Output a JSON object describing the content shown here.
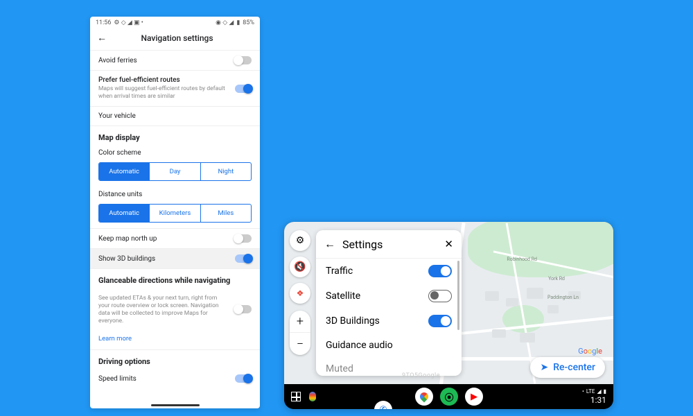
{
  "phone": {
    "status": {
      "time": "11:56",
      "battery": "85%"
    },
    "header": {
      "title": "Navigation settings"
    },
    "avoid_ferries": {
      "label": "Avoid ferries",
      "on": false
    },
    "fuel_efficient": {
      "label": "Prefer fuel-efficient routes",
      "sub": "Maps will suggest fuel-efficient routes by default when arrival times are similar",
      "on": true
    },
    "your_vehicle": {
      "label": "Your vehicle"
    },
    "map_display": {
      "title": "Map display"
    },
    "color_scheme": {
      "label": "Color scheme",
      "options": [
        "Automatic",
        "Day",
        "Night"
      ],
      "selected": 0
    },
    "distance_units": {
      "label": "Distance units",
      "options": [
        "Automatic",
        "Kilometers",
        "Miles"
      ],
      "selected": 0
    },
    "keep_north": {
      "label": "Keep map north up",
      "on": false
    },
    "show_3d": {
      "label": "Show 3D buildings",
      "on": true
    },
    "glanceable": {
      "title": "Glanceable directions while navigating",
      "sub": "See updated ETAs & your next turn, right from your route overview or lock screen. Navigation data will be collected to improve Maps for everyone.",
      "on": false,
      "learn": "Learn more"
    },
    "driving_options": {
      "title": "Driving options"
    },
    "speed_limits": {
      "label": "Speed limits",
      "on": true
    }
  },
  "auto": {
    "panel": {
      "title": "Settings",
      "traffic": {
        "label": "Traffic",
        "on": true
      },
      "satellite": {
        "label": "Satellite",
        "on": false
      },
      "buildings_3d": {
        "label": "3D Buildings",
        "on": true
      },
      "guidance_audio": {
        "label": "Guidance audio"
      },
      "muted": {
        "label": "Muted"
      }
    },
    "recenter": "Re-center",
    "map_labels": {
      "rd1": "Robinhood Rd",
      "rd2": "Paddington Ln",
      "rd3": "York Rd"
    },
    "watermark": "9TO5Google",
    "dock": {
      "net": "LTE",
      "time": "1:31"
    }
  }
}
